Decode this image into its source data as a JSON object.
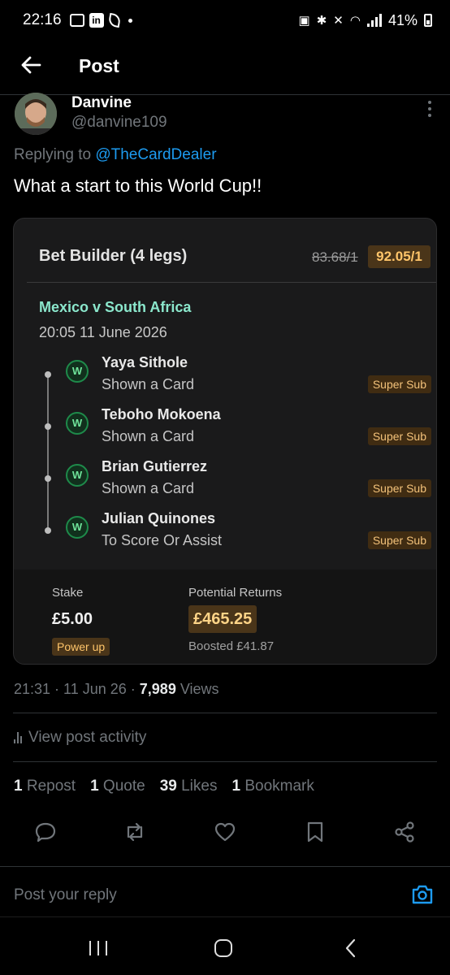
{
  "status": {
    "time": "22:16",
    "battery": "41%",
    "left_icons": [
      "image-icon",
      "linkedin-icon",
      "leaf-icon",
      "dot-icon"
    ],
    "right_icons": [
      "battery-saver-icon",
      "bluetooth-icon",
      "mute-icon",
      "wifi-icon",
      "signal-icon",
      "battery-icon"
    ]
  },
  "header": {
    "title": "Post",
    "back_icon": "back-arrow-icon"
  },
  "author": {
    "name": "Danvine",
    "handle": "@danvine109"
  },
  "post": {
    "reply_prefix": "Replying to ",
    "reply_to": "@TheCardDealer",
    "text": "What a start to this World Cup!!"
  },
  "bet": {
    "title": "Bet Builder (4 legs)",
    "odds_old": "83.68/1",
    "odds_new": "92.05/1",
    "match": "Mexico v South Africa",
    "match_time": "20:05 11 June 2026",
    "legs": [
      {
        "badge": "W",
        "name": "Yaya Sithole",
        "market": "Shown a Card",
        "tag": "Super Sub"
      },
      {
        "badge": "W",
        "name": "Teboho Mokoena",
        "market": "Shown a Card",
        "tag": "Super Sub"
      },
      {
        "badge": "W",
        "name": "Brian Gutierrez",
        "market": "Shown a Card",
        "tag": "Super Sub"
      },
      {
        "badge": "W",
        "name": "Julian Quinones",
        "market": "To Score Or Assist",
        "tag": "Super Sub"
      }
    ],
    "stake_label": "Stake",
    "stake_value": "£5.00",
    "power_up": "Power up",
    "returns_label": "Potential Returns",
    "returns_value": "£465.25",
    "boosted": "Boosted £41.87"
  },
  "meta": {
    "time": "21:31",
    "date": "11 Jun 26",
    "views_count": "7,989",
    "views_label": "Views",
    "activity": "View post activity"
  },
  "stats": {
    "reposts_count": "1",
    "reposts_label": "Repost",
    "quotes_count": "1",
    "quotes_label": "Quote",
    "likes_count": "39",
    "likes_label": "Likes",
    "bookmarks_count": "1",
    "bookmarks_label": "Bookmark"
  },
  "actions": [
    "reply-icon",
    "repost-icon",
    "like-icon",
    "bookmark-icon",
    "share-icon"
  ],
  "reply_box": {
    "placeholder": "Post your reply"
  },
  "colors": {
    "accent": "#1d9bf0",
    "boost": "#ffc56a",
    "match": "#8be7cc",
    "win": "#6fe39a"
  }
}
